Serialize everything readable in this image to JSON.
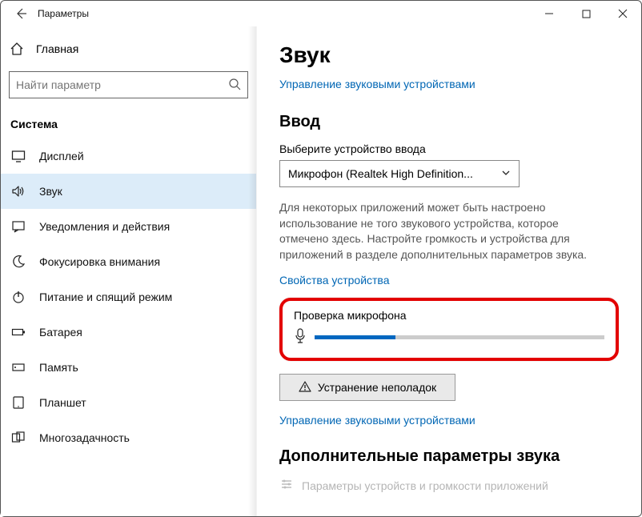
{
  "window": {
    "title": "Параметры"
  },
  "sidebar": {
    "home_label": "Главная",
    "search_placeholder": "Найти параметр",
    "section_title": "Система",
    "items": [
      {
        "label": "Дисплей"
      },
      {
        "label": "Звук"
      },
      {
        "label": "Уведомления и действия"
      },
      {
        "label": "Фокусировка внимания"
      },
      {
        "label": "Питание и спящий режим"
      },
      {
        "label": "Батарея"
      },
      {
        "label": "Память"
      },
      {
        "label": "Планшет"
      },
      {
        "label": "Многозадачность"
      }
    ]
  },
  "main": {
    "page_title": "Звук",
    "manage_devices_link": "Управление звуковыми устройствами",
    "input_heading": "Ввод",
    "input_label": "Выберите устройство ввода",
    "input_device": "Микрофон (Realtek High Definition...",
    "help_text": "Для некоторых приложений может быть настроено использование не того звукового устройства, которое отмечено здесь. Настройте громкость и устройства для приложений в разделе дополнительных параметров звука.",
    "device_props_link": "Свойства устройства",
    "mic_test_label": "Проверка микрофона",
    "troubleshoot_button": "Устранение неполадок",
    "manage_devices_link_2": "Управление звуковыми устройствами",
    "advanced_heading": "Дополнительные параметры звука",
    "cutoff_text": "Параметры устройств и громкости приложений"
  }
}
